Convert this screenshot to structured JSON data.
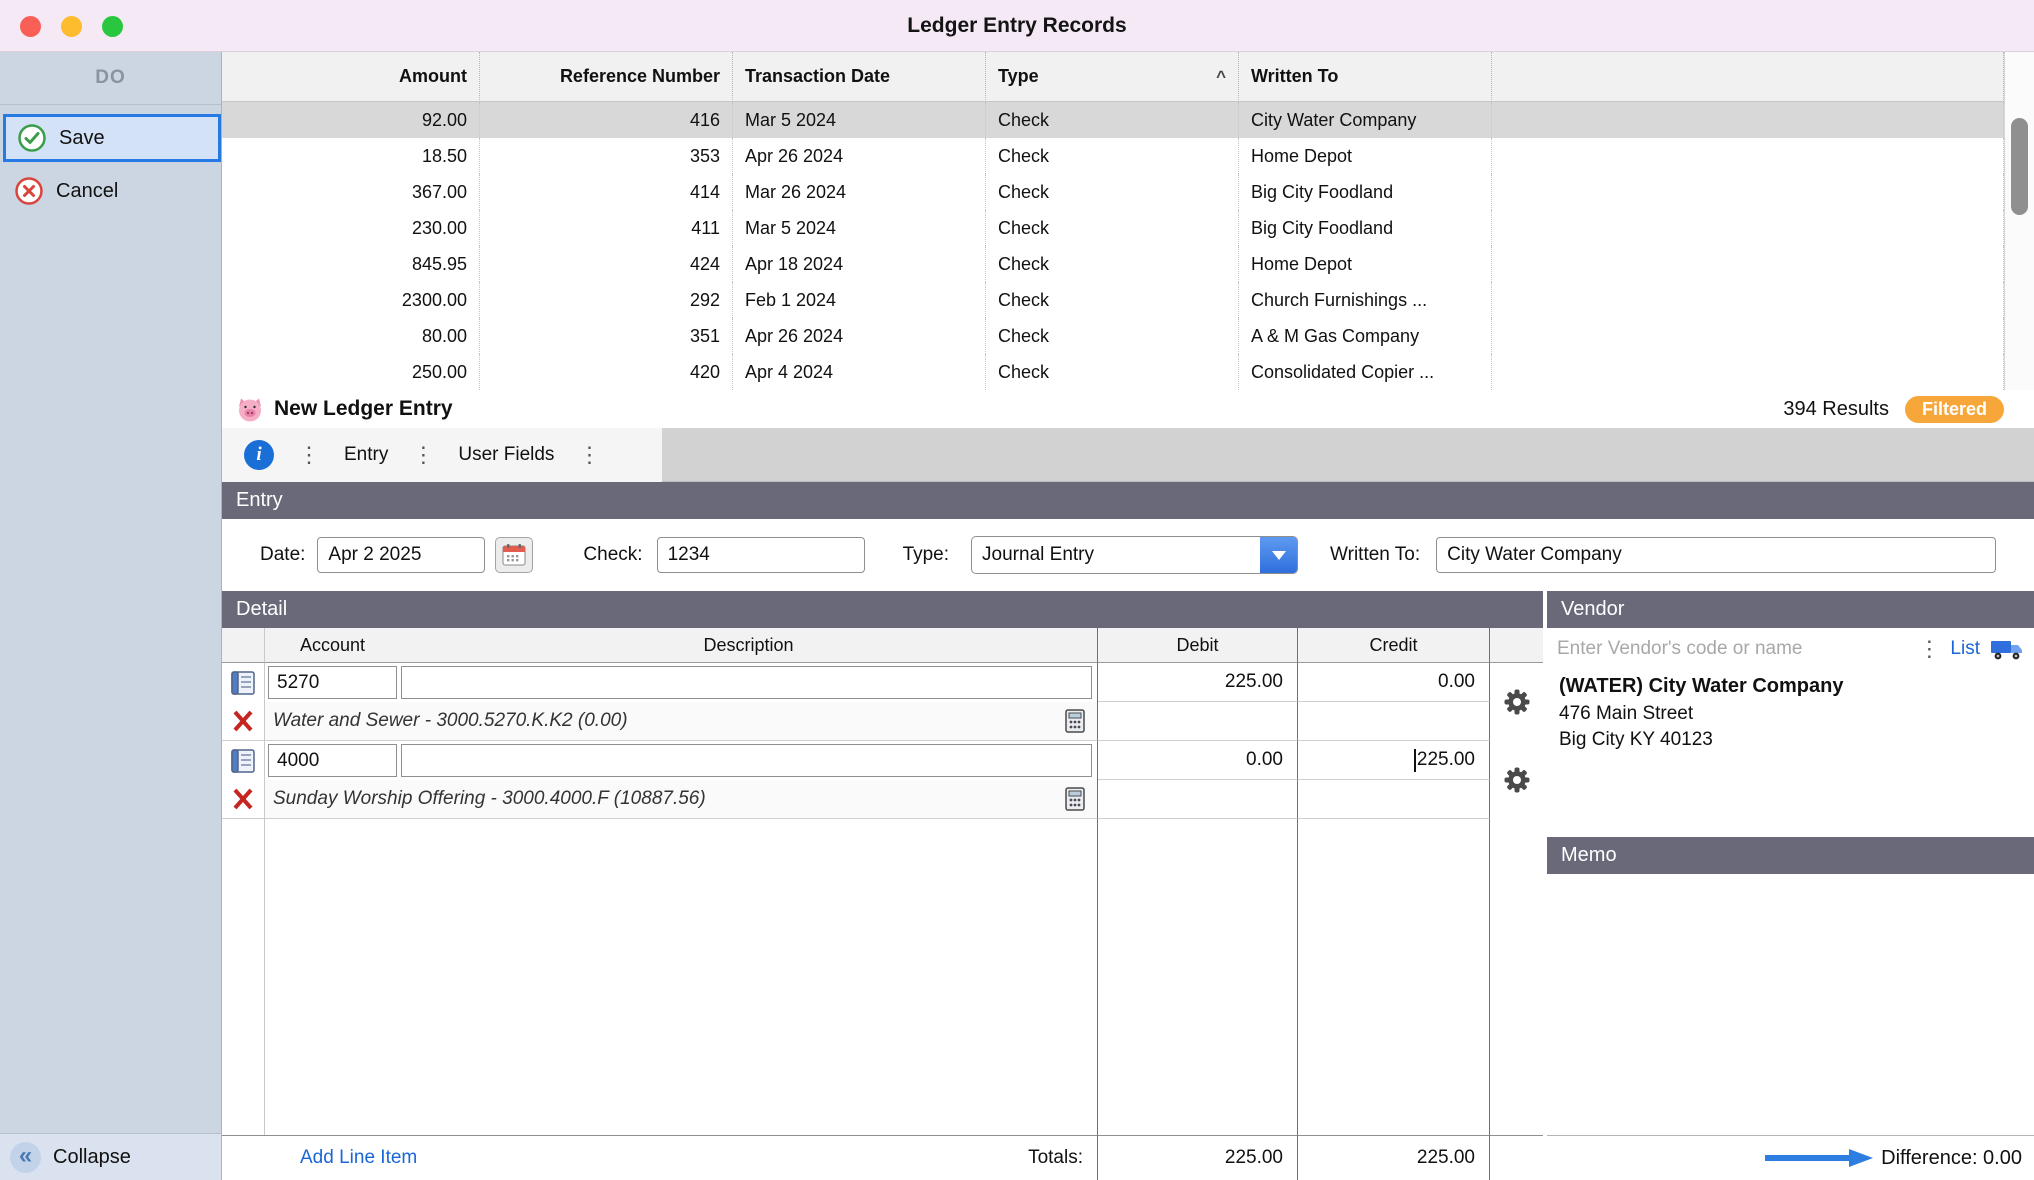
{
  "window": {
    "title": "Ledger Entry Records"
  },
  "sidebar": {
    "header": "DO",
    "save": "Save",
    "cancel": "Cancel",
    "collapse": "Collapse"
  },
  "records_table": {
    "columns": {
      "amount": "Amount",
      "ref": "Reference Number",
      "date": "Transaction Date",
      "type": "Type",
      "written": "Written To"
    },
    "sort_indicator": "^",
    "rows": [
      {
        "amount": "92.00",
        "ref": "416",
        "date": "Mar 5 2024",
        "type": "Check",
        "written": "City Water Company"
      },
      {
        "amount": "18.50",
        "ref": "353",
        "date": "Apr 26 2024",
        "type": "Check",
        "written": "Home Depot"
      },
      {
        "amount": "367.00",
        "ref": "414",
        "date": "Mar 26 2024",
        "type": "Check",
        "written": "Big City Foodland"
      },
      {
        "amount": "230.00",
        "ref": "411",
        "date": "Mar 5 2024",
        "type": "Check",
        "written": "Big City Foodland"
      },
      {
        "amount": "845.95",
        "ref": "424",
        "date": "Apr 18 2024",
        "type": "Check",
        "written": "Home Depot"
      },
      {
        "amount": "2300.00",
        "ref": "292",
        "date": "Feb 1 2024",
        "type": "Check",
        "written": "Church Furnishings ..."
      },
      {
        "amount": "80.00",
        "ref": "351",
        "date": "Apr 26 2024",
        "type": "Check",
        "written": "A & M Gas Company"
      },
      {
        "amount": "250.00",
        "ref": "420",
        "date": "Apr 4 2024",
        "type": "Check",
        "written": "Consolidated Copier ..."
      }
    ]
  },
  "record_bar": {
    "title": "New Ledger Entry",
    "results": "394 Results",
    "filtered": "Filtered"
  },
  "toolbar": {
    "info": "i",
    "tab_entry": "Entry",
    "tab_user_fields": "User Fields",
    "handle": "⋮"
  },
  "entry": {
    "section_title": "Entry",
    "date_label": "Date:",
    "date_value": "Apr 2 2025",
    "check_label": "Check:",
    "check_value": "1234",
    "type_label": "Type:",
    "type_value": "Journal Entry",
    "written_label": "Written To:",
    "written_value": "City Water Company"
  },
  "detail": {
    "section_title": "Detail",
    "columns": {
      "account": "Account",
      "description": "Description",
      "debit": "Debit",
      "credit": "Credit"
    },
    "lines": [
      {
        "account": "5270",
        "debit": "225.00",
        "credit": "0.00",
        "hint": "Water and Sewer - 3000.5270.K.K2 (0.00)"
      },
      {
        "account": "4000",
        "debit": "0.00",
        "credit": "225.00",
        "hint": "Sunday Worship Offering - 3000.4000.F (10887.56)"
      }
    ],
    "add_line": "Add Line Item",
    "totals_label": "Totals:",
    "total_debit": "225.00",
    "total_credit": "225.00"
  },
  "vendor": {
    "section_title": "Vendor",
    "placeholder": "Enter Vendor's code or name",
    "list": "List",
    "name": "(WATER) City Water Company",
    "address_line1": "476 Main Street",
    "address_line2": "Big City KY 40123"
  },
  "memo": {
    "section_title": "Memo"
  },
  "footer": {
    "difference": "Difference: 0.00"
  }
}
